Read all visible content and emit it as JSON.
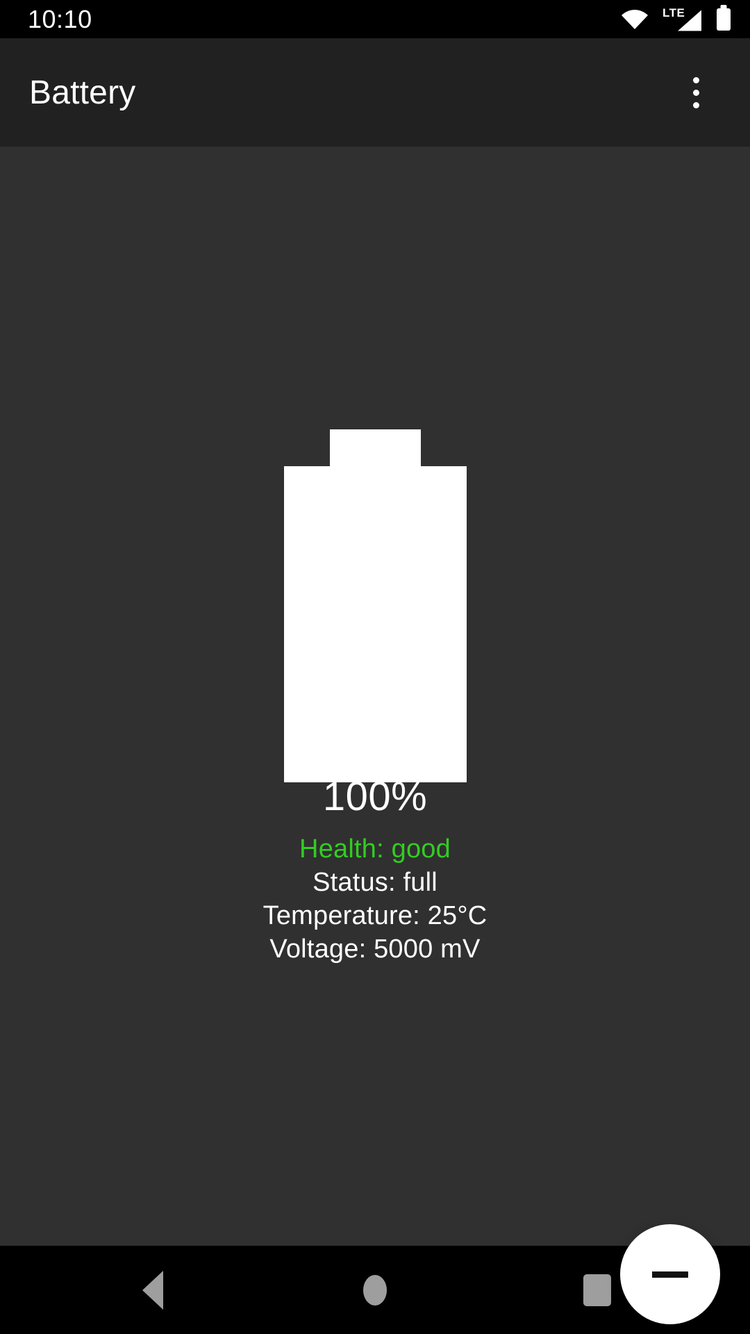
{
  "status_bar": {
    "clock": "10:10",
    "icons": [
      {
        "name": "wifi-icon",
        "label": "wifi"
      },
      {
        "name": "lte-signal-icon",
        "label": "LTE"
      },
      {
        "name": "battery-status-icon",
        "label": "battery-full"
      }
    ],
    "network_type": "LTE"
  },
  "app_bar": {
    "title": "Battery",
    "overflow_label": "More options"
  },
  "battery": {
    "percent_label": "100%",
    "percent_value": 100,
    "fill_color": "#ffffff",
    "health_label": "Health: good",
    "health_color": "#33cc22",
    "status_label": "Status: full",
    "temperature_label": "Temperature: 25°C",
    "voltage_label": "Voltage: 5000 mV"
  },
  "fab": {
    "name": "minus-fab",
    "icon": "minus-icon",
    "label": "—"
  },
  "nav_bar": {
    "back": "back-button",
    "home": "home-button",
    "recents": "recents-button"
  },
  "colors": {
    "background": "#303030",
    "app_bar": "#212121",
    "accent_green": "#33cc22",
    "nav_icon": "#9e9e9e"
  }
}
